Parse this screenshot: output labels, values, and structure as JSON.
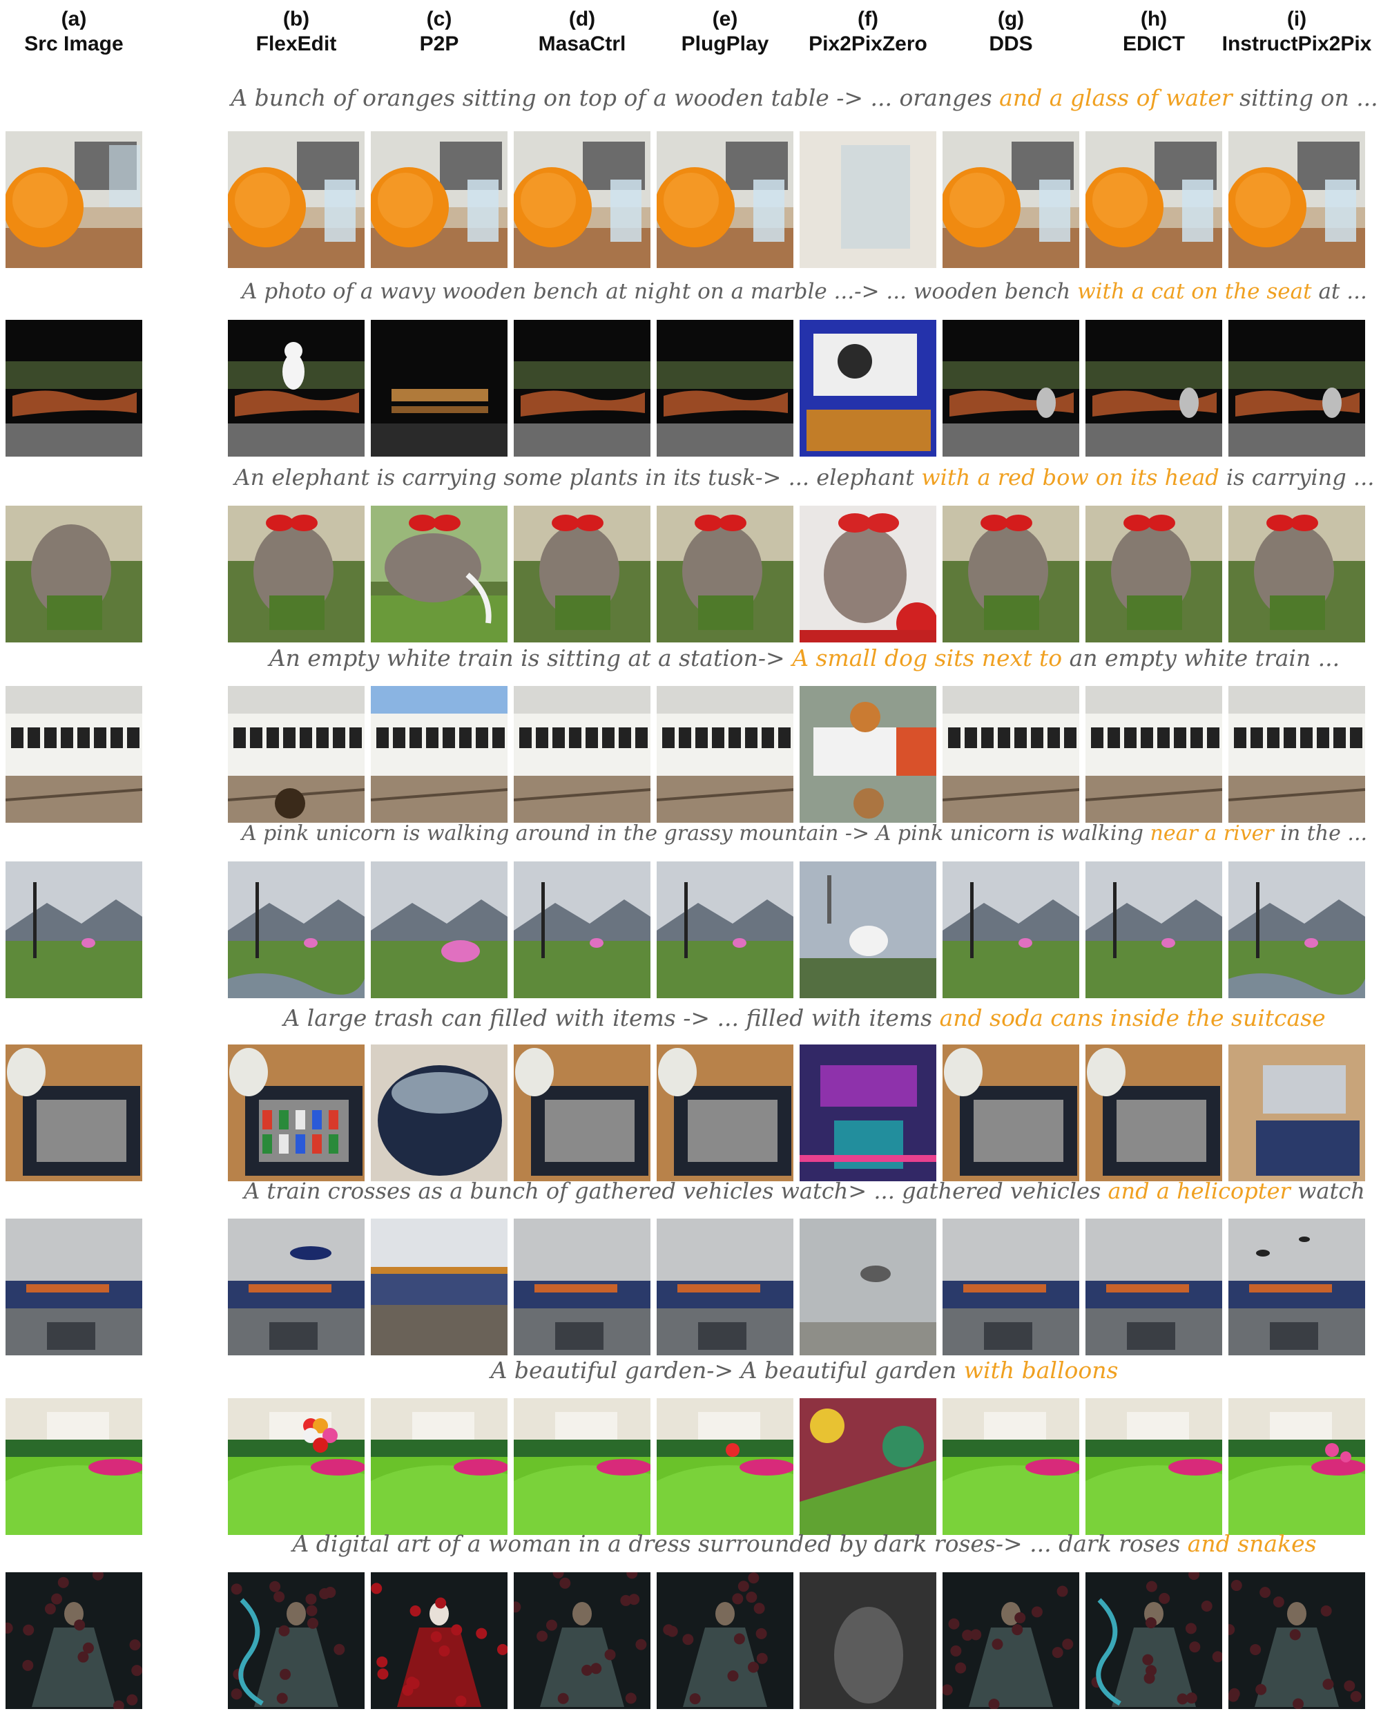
{
  "columns": [
    {
      "letter": "(a)",
      "name": "Src Image"
    },
    {
      "letter": "(b)",
      "name": "FlexEdit"
    },
    {
      "letter": "(c)",
      "name": "P2P"
    },
    {
      "letter": "(d)",
      "name": "MasaCtrl"
    },
    {
      "letter": "(e)",
      "name": "PlugPlay"
    },
    {
      "letter": "(f)",
      "name": "Pix2PixZero"
    },
    {
      "letter": "(g)",
      "name": "DDS"
    },
    {
      "letter": "(h)",
      "name": "EDICT"
    },
    {
      "letter": "(i)",
      "name": "InstructPix2Pix"
    }
  ],
  "rows": [
    {
      "caption_prefix": "A bunch of oranges sitting on top of a wooden table -> ... oranges ",
      "caption_highlight": "and a glass of water",
      "caption_suffix": " sitting on ...",
      "scene": "oranges"
    },
    {
      "caption_prefix": "A photo of a wavy wooden bench at night on a marble ...-> ... wooden bench ",
      "caption_highlight": "with a cat on the seat",
      "caption_suffix": " at ...",
      "scene": "bench"
    },
    {
      "caption_prefix": "An elephant is carrying some plants in its tusk-> ... elephant ",
      "caption_highlight": "with a red bow on its head",
      "caption_suffix": " is carrying ...",
      "scene": "elephant"
    },
    {
      "caption_prefix": "An empty white train is sitting at a station-> ",
      "caption_highlight": "A small dog sits next to",
      "caption_suffix": " an empty white train ...",
      "scene": "train"
    },
    {
      "caption_prefix": "A pink unicorn is walking around in the grassy mountain -> A pink unicorn is walking ",
      "caption_highlight": "near a river",
      "caption_suffix": " in the ...",
      "scene": "unicorn"
    },
    {
      "caption_prefix": "A large trash can filled with items -> ... filled with items ",
      "caption_highlight": "and soda cans inside the suitcase",
      "caption_suffix": "",
      "scene": "suitcase"
    },
    {
      "caption_prefix": "A train crosses as a bunch of gathered vehicles watch> ... gathered vehicles ",
      "caption_highlight": "and a helicopter",
      "caption_suffix": " watch",
      "scene": "crossing"
    },
    {
      "caption_prefix": "A beautiful garden-> A beautiful garden ",
      "caption_highlight": "with balloons",
      "caption_suffix": "",
      "scene": "garden"
    },
    {
      "caption_prefix": "A digital art of a woman in a dress surrounded by dark roses-> ... dark roses ",
      "caption_highlight": "and snakes",
      "caption_suffix": "",
      "scene": "woman"
    }
  ],
  "colors": {
    "caption_text": "#5f5f5f",
    "caption_highlight": "#f0a020",
    "header_text": "#111111"
  }
}
